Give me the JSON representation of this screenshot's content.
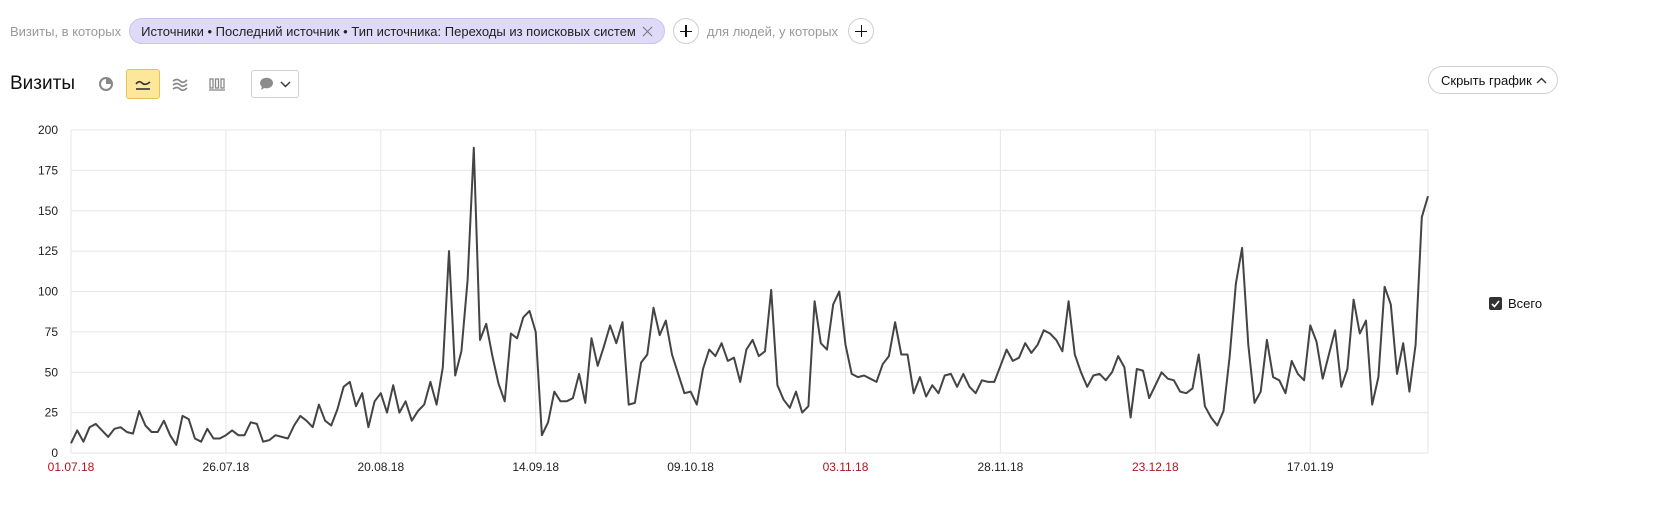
{
  "filters": {
    "visits_label": "Визиты, в которых",
    "segment_chip": "Источники • Последний источник • Тип источника: Переходы из поисковых систем",
    "people_label": "для людей, у которых"
  },
  "header": {
    "title": "Визиты",
    "view_modes": [
      {
        "icon": "pie-chart-icon",
        "active": false
      },
      {
        "icon": "line-chart-icon",
        "active": true
      },
      {
        "icon": "area-chart-icon",
        "active": false
      },
      {
        "icon": "bar-chart-icon",
        "active": false
      }
    ],
    "notes_icon": "speech-bubble-icon",
    "hide_chart_label": "Скрыть график"
  },
  "legend": {
    "series_label": "Всего",
    "checked": true
  },
  "colors": {
    "line": "#444444",
    "weekend_tick": "#b5131b",
    "grid": "#e6e6e6",
    "chip_bg": "#dedaf8",
    "active_mode_bg": "#fde79a"
  },
  "chart_data": {
    "type": "line",
    "ylim": [
      0,
      200
    ],
    "y_ticks": [
      "0",
      "25",
      "50",
      "75",
      "100",
      "125",
      "150",
      "175",
      "200"
    ],
    "x_tick_labels": [
      {
        "label": "01.07.18",
        "weekend": true
      },
      {
        "label": "26.07.18",
        "weekend": false
      },
      {
        "label": "20.08.18",
        "weekend": false
      },
      {
        "label": "14.09.18",
        "weekend": false
      },
      {
        "label": "09.10.18",
        "weekend": false
      },
      {
        "label": "03.11.18",
        "weekend": true
      },
      {
        "label": "28.11.18",
        "weekend": false
      },
      {
        "label": "23.12.18",
        "weekend": true
      },
      {
        "label": "17.01.19",
        "weekend": false
      }
    ],
    "x_start": "01.07.18",
    "x_end": "06.02.19",
    "grid": true,
    "legend_position": "right",
    "series": [
      {
        "name": "Всего",
        "values": [
          6,
          14,
          7,
          16,
          18,
          14,
          10,
          15,
          16,
          13,
          12,
          26,
          17,
          13,
          13,
          20,
          11,
          5,
          23,
          21,
          9,
          7,
          15,
          9,
          9,
          11,
          14,
          11,
          11,
          19,
          18,
          7,
          8,
          11,
          10,
          9,
          17,
          23,
          20,
          16,
          30,
          20,
          17,
          27,
          41,
          44,
          29,
          37,
          16,
          32,
          37,
          25,
          42,
          25,
          32,
          20,
          26,
          30,
          44,
          30,
          53,
          125,
          48,
          63,
          107,
          189,
          70,
          80,
          60,
          43,
          32,
          74,
          71,
          84,
          88,
          75,
          11,
          19,
          38,
          32,
          32,
          34,
          49,
          31,
          71,
          54,
          66,
          79,
          68,
          81,
          30,
          31,
          56,
          61,
          90,
          73,
          82,
          61,
          49,
          37,
          38,
          30,
          52,
          64,
          60,
          68,
          57,
          59,
          44,
          64,
          70,
          60,
          63,
          101,
          42,
          33,
          28,
          38,
          25,
          29,
          94,
          68,
          64,
          92,
          100,
          67,
          49,
          47,
          48,
          46,
          44,
          55,
          60,
          81,
          61,
          61,
          37,
          47,
          35,
          42,
          37,
          48,
          49,
          41,
          49,
          41,
          37,
          45,
          44,
          44,
          54,
          64,
          57,
          59,
          68,
          62,
          67,
          76,
          74,
          70,
          63,
          94,
          61,
          50,
          41,
          48,
          49,
          45,
          50,
          60,
          53,
          22,
          52,
          51,
          34,
          42,
          50,
          46,
          45,
          38,
          37,
          40,
          61,
          29,
          22,
          17,
          26,
          60,
          105,
          127,
          67,
          31,
          38,
          70,
          47,
          45,
          37,
          57,
          49,
          45,
          79,
          69,
          46,
          61,
          76,
          41,
          52,
          95,
          74,
          82,
          30,
          47,
          103,
          92,
          49,
          68,
          38,
          67,
          146,
          159
        ]
      }
    ]
  }
}
